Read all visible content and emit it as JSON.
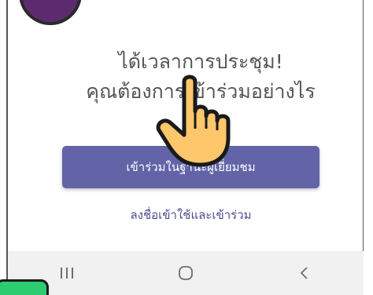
{
  "prompt": {
    "line1": "ได้เวลาการประชุม!",
    "line2": "คุณต้องการเข้าร่วมอย่างไร"
  },
  "actions": {
    "join_as_guest": "เข้าร่วมในฐานะผู้เยี่ยมชม",
    "sign_in_and_join": "ลงชื่อเข้าใช้และเข้าร่วม"
  },
  "navbar": {
    "recents_icon": "recent-apps-icon",
    "home_icon": "home-icon",
    "back_icon": "back-icon"
  },
  "colors": {
    "accent": "#6264a7",
    "link": "#4a4c8c",
    "heading_text": "#555555",
    "navbar_bg": "#f1f1f1"
  }
}
